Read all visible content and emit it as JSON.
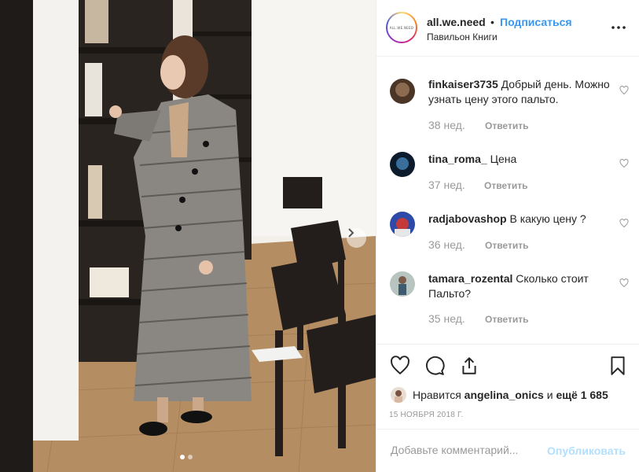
{
  "header": {
    "username": "all.we.need",
    "separator": "•",
    "follow_label": "Подписаться",
    "location": "Павильон Книги",
    "logo_text": "ALL.WE.NEED"
  },
  "comments": [
    {
      "username": "finkaiser3735",
      "text": "Добрый день. Можно узнать цену этого пальто.",
      "time": "38 нед.",
      "reply_label": "Ответить"
    },
    {
      "username": "tina_roma_",
      "text": "Цена",
      "time": "37 нед.",
      "reply_label": "Ответить"
    },
    {
      "username": "radjabovashop",
      "text": "В какую цену ?",
      "time": "36 нед.",
      "reply_label": "Ответить"
    },
    {
      "username": "tamara_rozental",
      "text": "Сколько стоит Пальто?",
      "time": "35 нед.",
      "reply_label": "Ответить"
    }
  ],
  "likes": {
    "prefix": "Нравится",
    "user": "angelina_onics",
    "joiner": "и",
    "others": "ещё 1 685"
  },
  "date": "15 ноября 2018 г.",
  "add_comment": {
    "placeholder": "Добавьте комментарий...",
    "post_label": "Опубликовать"
  },
  "carousel": {
    "total": 2,
    "active": 1
  },
  "colors": {
    "accent": "#3897f0",
    "post_disabled": "#b2dffc",
    "muted": "#999999",
    "text": "#262626"
  }
}
